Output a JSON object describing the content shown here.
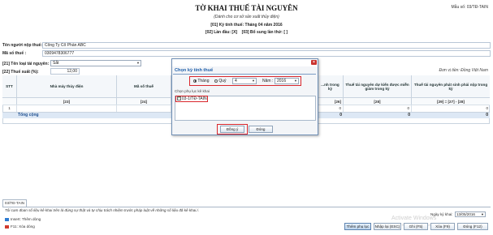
{
  "form": {
    "title": "TỜ KHAI THUẾ TÀI NGUYÊN",
    "subtitle": "(Dành cho cơ sở sản xuất thủy điện)",
    "period": "[01] Kỳ tính thuế: Tháng 04 năm 2016",
    "first_time": "[02] Lần đầu: [X]",
    "supplement": "[03] Bổ sung lần thứ: [ ]",
    "form_no": "Mẫu số: 03/TĐ-TAIN"
  },
  "taxpayer": {
    "name_label": "Tên người nộp thuế:",
    "name_value": "Công Ty Cổ Phần ABC",
    "tax_code_label": "Mã số thuế :",
    "tax_code_value": "0309478306777"
  },
  "resource": {
    "type_label": "[21] Tên loại tài nguyên:",
    "type_value": "Sắt",
    "rate_label": "[22] Thuế suất (%):",
    "rate_value": "12,00"
  },
  "unit_text": "Đơn vị tiền: Đồng Việt Nam",
  "table": {
    "headers": {
      "stt": "STT",
      "plant": "Nhà máy thủy điện",
      "tax_code": "Mã số thuế",
      "period_col": "...nh trong kỳ",
      "exempt": "Thuế tài nguyên dự kiến được miễn giảm trong kỳ",
      "payable": "Thuế tài nguyên phát sinh phải nộp trong kỳ"
    },
    "codes": {
      "plant": "[23]",
      "tax_code": "[24]",
      "period_col": "[26]",
      "exempt": "[28]",
      "payable": "[29] = [27] - [28]"
    },
    "row": {
      "stt": "1",
      "c26": "0",
      "c28": "0",
      "c29": "0"
    },
    "total": {
      "label": "Tổng cộng",
      "c26": "0",
      "c28": "0",
      "c29": "0"
    }
  },
  "dialog": {
    "title": "Chọn kỳ tính thuế",
    "month_label": "Tháng",
    "quarter_label": "Quý",
    "month_value": "4",
    "year_label": "Năm :",
    "year_value": "2016",
    "appendix_label": "Chọn phụ lục kê khai",
    "appendix_item": "03-1/TĐ-TAIN",
    "ok_label": "Đồng ý",
    "close_label": "Đóng"
  },
  "tabs": {
    "active": "03/TĐ-TAIN"
  },
  "footer": {
    "declaration": "Tôi cam đoan số liệu kê khai trên là đúng sự thật và tự chịu trách nhiệm trước pháp luật về những số liệu đã kê khai./.",
    "date_label": "Ngày ký khai:",
    "date_value": "13/05/2016",
    "hint_insert": "Insert: Thêm dòng",
    "hint_delete": "F11: Xóa dòng",
    "watermark_title": "Activate Windows",
    "watermark_sub": "Go to Settings to activate Windows.",
    "buttons": {
      "appendix": "Thêm phụ lục",
      "import": "Nhập lại (ESC)",
      "save": "Ghi (F5)",
      "delete": "Xóa (F9)",
      "close": "Đóng (F12)"
    }
  },
  "colors": {
    "accent": "#1f5faa",
    "highlight_box": "#d9262c",
    "total_row": "#dde8f5"
  }
}
